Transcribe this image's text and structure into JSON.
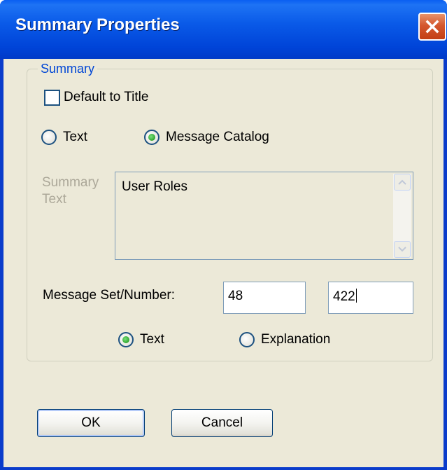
{
  "window": {
    "title": "Summary Properties",
    "close_icon": "close-icon"
  },
  "group": {
    "label": "Summary",
    "default_to_title": {
      "label": "Default to Title",
      "checked": false
    },
    "source_options": [
      {
        "label": "Text",
        "checked": false
      },
      {
        "label": "Message Catalog",
        "checked": true
      }
    ],
    "summary_text": {
      "label_line1": "Summary",
      "label_line2": "Text",
      "value": "User Roles",
      "enabled": false
    },
    "message_set_number": {
      "label": "Message Set/Number:",
      "set_value": "48",
      "number_value": "422"
    },
    "text_type_options": [
      {
        "label": "Text",
        "checked": true
      },
      {
        "label": "Explanation",
        "checked": false
      }
    ]
  },
  "buttons": {
    "ok": "OK",
    "cancel": "Cancel"
  },
  "colors": {
    "titlebar": "#0a5ae8",
    "client": "#ece9d8",
    "group_label": "#0046d5",
    "disabled_text": "#aca899",
    "radio_checked": "#2fa52f",
    "close_button": "#d4572e"
  }
}
